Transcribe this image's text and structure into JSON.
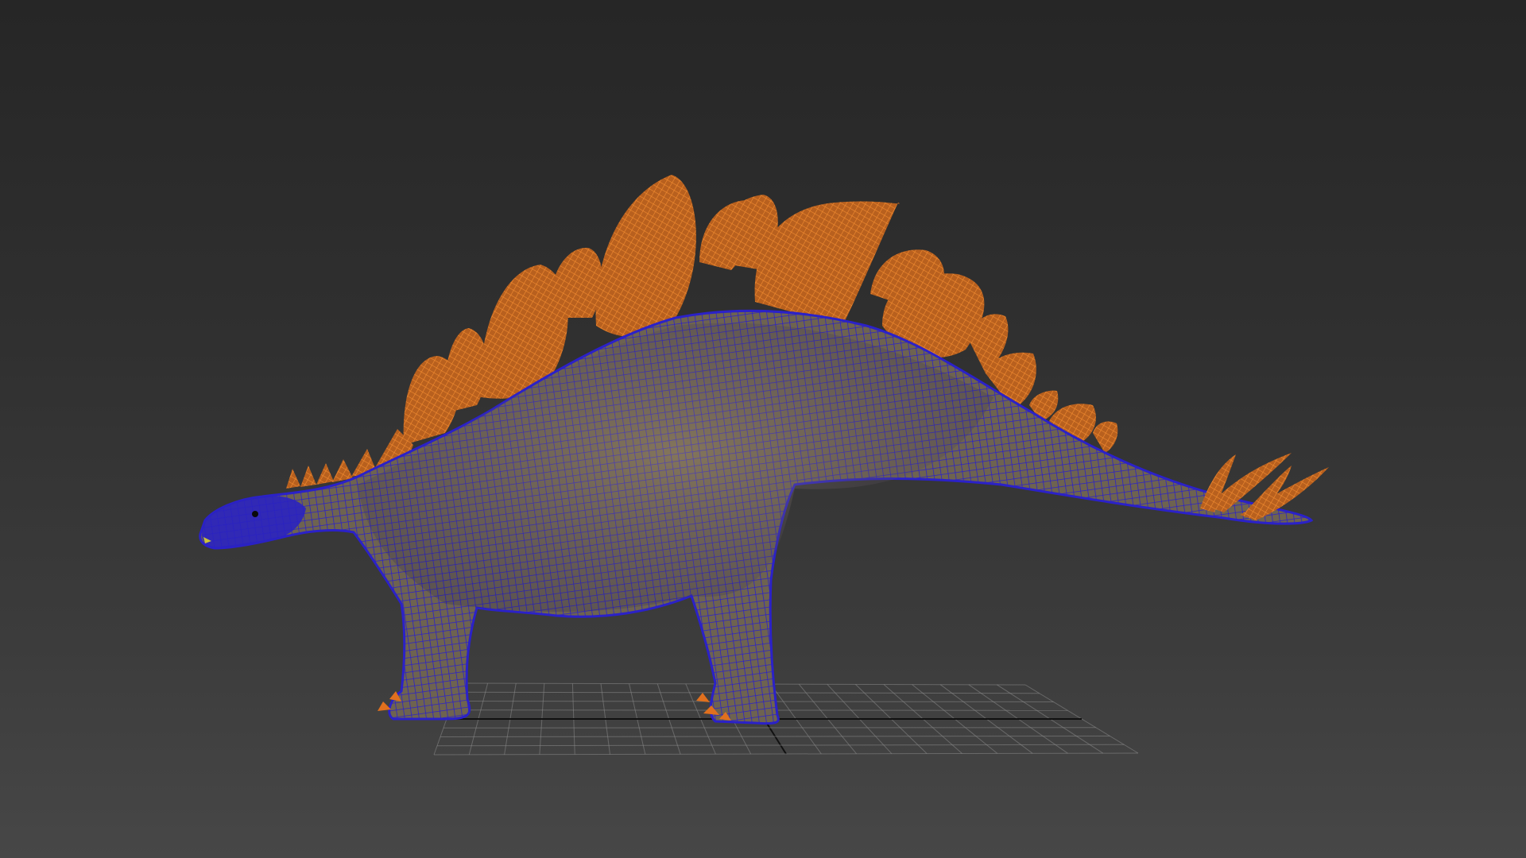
{
  "viewport": {
    "background_top": "#262626",
    "background_bottom": "#474747"
  },
  "model": {
    "body_wire_color": "#2b21c8",
    "body_skin_color": "#8a7a5e",
    "plate_color": "#e0701e",
    "plate_wire_color": "#f08a30",
    "eye_color": "#0a0a0a"
  },
  "grid": {
    "line_color": "#8a8a8a",
    "axis_color": "#111111"
  }
}
